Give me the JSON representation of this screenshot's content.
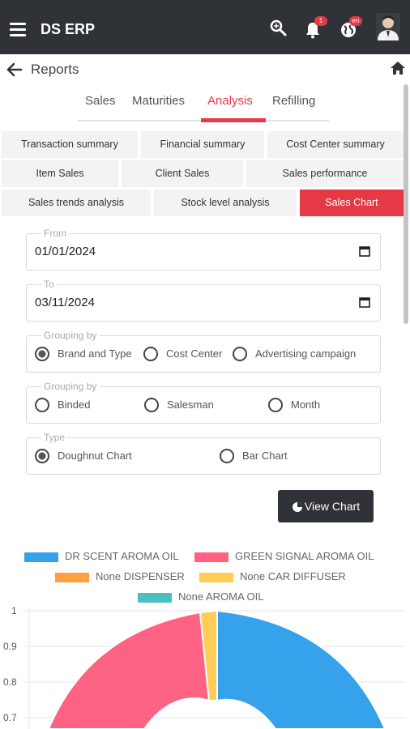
{
  "header": {
    "app_title": "DS ERP",
    "notification_count": "1",
    "language_badge": "en",
    "icons": [
      "menu-icon",
      "search-icon",
      "bell-icon",
      "globe-icon",
      "avatar"
    ]
  },
  "subheader": {
    "title": "Reports"
  },
  "tabs": [
    {
      "label": "Sales"
    },
    {
      "label": "Maturities"
    },
    {
      "label": "Analysis",
      "active": true
    },
    {
      "label": "Refilling"
    }
  ],
  "report_chips": [
    {
      "label": "Transaction summary"
    },
    {
      "label": "Financial summary"
    },
    {
      "label": "Cost Center summary"
    },
    {
      "label": "Item Sales"
    },
    {
      "label": "Client Sales"
    },
    {
      "label": "Sales performance"
    },
    {
      "label": "Sales trends analysis"
    },
    {
      "label": "Stock level analysis"
    },
    {
      "label": "Sales Chart",
      "active": true
    }
  ],
  "form": {
    "from": {
      "legend": "From",
      "value": "01/01/2024"
    },
    "to": {
      "legend": "To",
      "value": "03/11/2024"
    },
    "grouping1": {
      "legend": "Grouping by",
      "options": [
        "Brand and Type",
        "Cost Center",
        "Advertising campaign"
      ],
      "selected": "Brand and Type"
    },
    "grouping2": {
      "legend": "Grouping by",
      "options": [
        "Binded",
        "Salesman",
        "Month"
      ],
      "selected": ""
    },
    "type": {
      "legend": "Type",
      "options": [
        "Doughnut Chart",
        "Bar Chart"
      ],
      "selected": "Doughnut Chart"
    },
    "view_button": "View Chart"
  },
  "colors": {
    "accent": "#e63946",
    "dark": "#2f3237"
  },
  "chart_data": {
    "type": "doughnut",
    "series": [
      {
        "name": "DR SCENT AROMA OIL",
        "color": "#36a2eb"
      },
      {
        "name": "GREEN SIGNAL AROMA OIL",
        "color": "#ff6384"
      },
      {
        "name": "None DISPENSER",
        "color": "#ff9f40"
      },
      {
        "name": "None CAR DIFFUSER",
        "color": "#ffcd56"
      },
      {
        "name": "None AROMA OIL",
        "color": "#4bc0c0"
      }
    ],
    "y_ticks": [
      "1",
      "0.9",
      "0.8",
      "0.7"
    ],
    "ylim": [
      0.7,
      1
    ],
    "grid": true,
    "legend_position": "top"
  }
}
